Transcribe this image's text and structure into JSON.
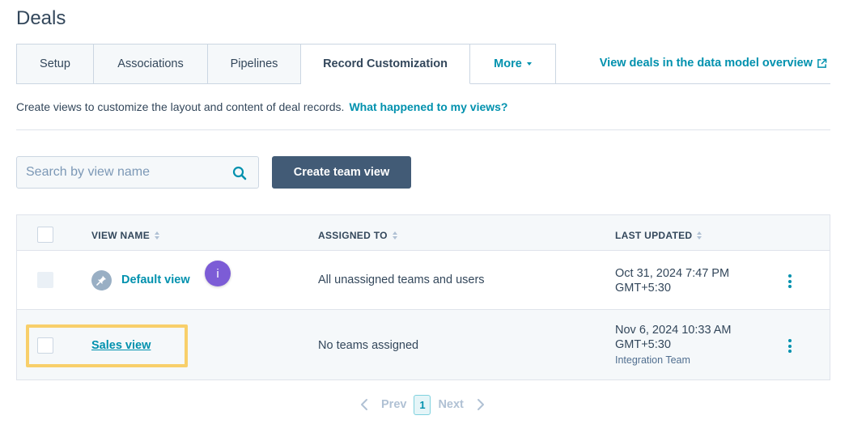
{
  "page": {
    "title": "Deals"
  },
  "tabs": [
    {
      "label": "Setup"
    },
    {
      "label": "Associations"
    },
    {
      "label": "Pipelines"
    },
    {
      "label": "Record Customization"
    },
    {
      "label": "More"
    }
  ],
  "data_model_link": "View deals in the data model overview",
  "description": {
    "text": "Create views to customize the layout and content of deal records.",
    "link": "What happened to my views?"
  },
  "search": {
    "placeholder": "Search by view name",
    "value": ""
  },
  "create_button": "Create team view",
  "table": {
    "columns": [
      "VIEW NAME",
      "ASSIGNED TO",
      "LAST UPDATED"
    ],
    "rows": [
      {
        "name": "Default view",
        "assigned": "All unassigned teams and users",
        "updated_line1": "Oct 31, 2024 7:47 PM",
        "updated_line2": "GMT+5:30",
        "updated_by": ""
      },
      {
        "name": "Sales view",
        "assigned": "No teams assigned",
        "updated_line1": "Nov 6, 2024 10:33 AM",
        "updated_line2": "GMT+5:30",
        "updated_by": "Integration Team"
      }
    ]
  },
  "info_badge": "i",
  "pagination": {
    "prev": "Prev",
    "current": "1",
    "next": "Next"
  },
  "colors": {
    "accent": "#0091ae",
    "button": "#425b76",
    "highlight": "#f8cf6a",
    "badge": "#7c5cd6"
  }
}
